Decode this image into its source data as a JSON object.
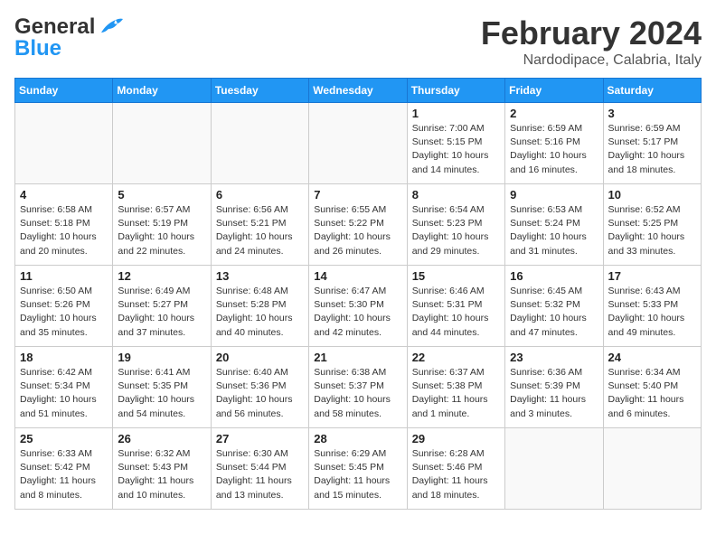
{
  "header": {
    "logo_line1": "General",
    "logo_line2": "Blue",
    "title": "February 2024",
    "subtitle": "Nardodipace, Calabria, Italy"
  },
  "days_of_week": [
    "Sunday",
    "Monday",
    "Tuesday",
    "Wednesday",
    "Thursday",
    "Friday",
    "Saturday"
  ],
  "weeks": [
    [
      {
        "day": "",
        "info": ""
      },
      {
        "day": "",
        "info": ""
      },
      {
        "day": "",
        "info": ""
      },
      {
        "day": "",
        "info": ""
      },
      {
        "day": "1",
        "info": "Sunrise: 7:00 AM\nSunset: 5:15 PM\nDaylight: 10 hours\nand 14 minutes."
      },
      {
        "day": "2",
        "info": "Sunrise: 6:59 AM\nSunset: 5:16 PM\nDaylight: 10 hours\nand 16 minutes."
      },
      {
        "day": "3",
        "info": "Sunrise: 6:59 AM\nSunset: 5:17 PM\nDaylight: 10 hours\nand 18 minutes."
      }
    ],
    [
      {
        "day": "4",
        "info": "Sunrise: 6:58 AM\nSunset: 5:18 PM\nDaylight: 10 hours\nand 20 minutes."
      },
      {
        "day": "5",
        "info": "Sunrise: 6:57 AM\nSunset: 5:19 PM\nDaylight: 10 hours\nand 22 minutes."
      },
      {
        "day": "6",
        "info": "Sunrise: 6:56 AM\nSunset: 5:21 PM\nDaylight: 10 hours\nand 24 minutes."
      },
      {
        "day": "7",
        "info": "Sunrise: 6:55 AM\nSunset: 5:22 PM\nDaylight: 10 hours\nand 26 minutes."
      },
      {
        "day": "8",
        "info": "Sunrise: 6:54 AM\nSunset: 5:23 PM\nDaylight: 10 hours\nand 29 minutes."
      },
      {
        "day": "9",
        "info": "Sunrise: 6:53 AM\nSunset: 5:24 PM\nDaylight: 10 hours\nand 31 minutes."
      },
      {
        "day": "10",
        "info": "Sunrise: 6:52 AM\nSunset: 5:25 PM\nDaylight: 10 hours\nand 33 minutes."
      }
    ],
    [
      {
        "day": "11",
        "info": "Sunrise: 6:50 AM\nSunset: 5:26 PM\nDaylight: 10 hours\nand 35 minutes."
      },
      {
        "day": "12",
        "info": "Sunrise: 6:49 AM\nSunset: 5:27 PM\nDaylight: 10 hours\nand 37 minutes."
      },
      {
        "day": "13",
        "info": "Sunrise: 6:48 AM\nSunset: 5:28 PM\nDaylight: 10 hours\nand 40 minutes."
      },
      {
        "day": "14",
        "info": "Sunrise: 6:47 AM\nSunset: 5:30 PM\nDaylight: 10 hours\nand 42 minutes."
      },
      {
        "day": "15",
        "info": "Sunrise: 6:46 AM\nSunset: 5:31 PM\nDaylight: 10 hours\nand 44 minutes."
      },
      {
        "day": "16",
        "info": "Sunrise: 6:45 AM\nSunset: 5:32 PM\nDaylight: 10 hours\nand 47 minutes."
      },
      {
        "day": "17",
        "info": "Sunrise: 6:43 AM\nSunset: 5:33 PM\nDaylight: 10 hours\nand 49 minutes."
      }
    ],
    [
      {
        "day": "18",
        "info": "Sunrise: 6:42 AM\nSunset: 5:34 PM\nDaylight: 10 hours\nand 51 minutes."
      },
      {
        "day": "19",
        "info": "Sunrise: 6:41 AM\nSunset: 5:35 PM\nDaylight: 10 hours\nand 54 minutes."
      },
      {
        "day": "20",
        "info": "Sunrise: 6:40 AM\nSunset: 5:36 PM\nDaylight: 10 hours\nand 56 minutes."
      },
      {
        "day": "21",
        "info": "Sunrise: 6:38 AM\nSunset: 5:37 PM\nDaylight: 10 hours\nand 58 minutes."
      },
      {
        "day": "22",
        "info": "Sunrise: 6:37 AM\nSunset: 5:38 PM\nDaylight: 11 hours\nand 1 minute."
      },
      {
        "day": "23",
        "info": "Sunrise: 6:36 AM\nSunset: 5:39 PM\nDaylight: 11 hours\nand 3 minutes."
      },
      {
        "day": "24",
        "info": "Sunrise: 6:34 AM\nSunset: 5:40 PM\nDaylight: 11 hours\nand 6 minutes."
      }
    ],
    [
      {
        "day": "25",
        "info": "Sunrise: 6:33 AM\nSunset: 5:42 PM\nDaylight: 11 hours\nand 8 minutes."
      },
      {
        "day": "26",
        "info": "Sunrise: 6:32 AM\nSunset: 5:43 PM\nDaylight: 11 hours\nand 10 minutes."
      },
      {
        "day": "27",
        "info": "Sunrise: 6:30 AM\nSunset: 5:44 PM\nDaylight: 11 hours\nand 13 minutes."
      },
      {
        "day": "28",
        "info": "Sunrise: 6:29 AM\nSunset: 5:45 PM\nDaylight: 11 hours\nand 15 minutes."
      },
      {
        "day": "29",
        "info": "Sunrise: 6:28 AM\nSunset: 5:46 PM\nDaylight: 11 hours\nand 18 minutes."
      },
      {
        "day": "",
        "info": ""
      },
      {
        "day": "",
        "info": ""
      }
    ]
  ]
}
